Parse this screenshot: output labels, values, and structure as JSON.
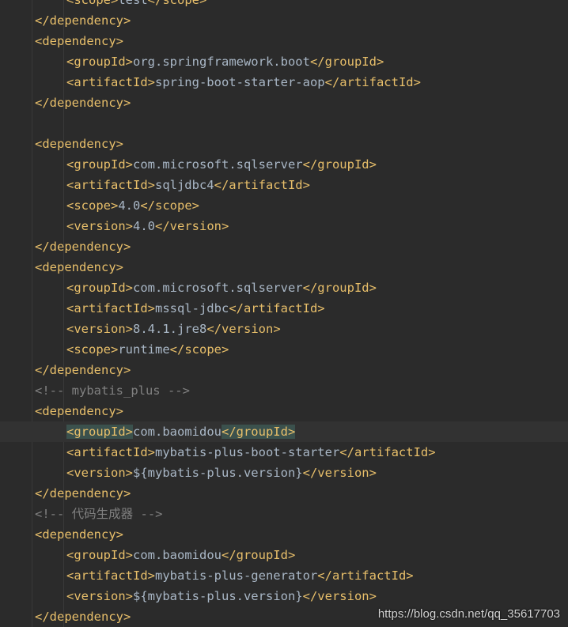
{
  "editor": {
    "language": "xml",
    "colors": {
      "background": "#2b2b2b",
      "tag": "#e8bf6a",
      "text": "#a9b7c6",
      "comment": "#808080",
      "current_line": "#323232",
      "matched_tag_highlight": "#3b514d"
    },
    "lines": [
      {
        "indent": 2,
        "tag": "scope",
        "text": "test",
        "partial": true
      },
      {
        "indent": 1,
        "close": "dependency"
      },
      {
        "indent": 1,
        "open": "dependency"
      },
      {
        "indent": 2,
        "tag": "groupId",
        "text": "org.springframework.boot"
      },
      {
        "indent": 2,
        "tag": "artifactId",
        "text": "spring-boot-starter-aop"
      },
      {
        "indent": 1,
        "close": "dependency"
      },
      {
        "blank": true
      },
      {
        "indent": 1,
        "open": "dependency"
      },
      {
        "indent": 2,
        "tag": "groupId",
        "text": "com.microsoft.sqlserver"
      },
      {
        "indent": 2,
        "tag": "artifactId",
        "text": "sqljdbc4"
      },
      {
        "indent": 2,
        "tag": "scope",
        "text": "4.0"
      },
      {
        "indent": 2,
        "tag": "version",
        "text": "4.0"
      },
      {
        "indent": 1,
        "close": "dependency"
      },
      {
        "indent": 1,
        "open": "dependency"
      },
      {
        "indent": 2,
        "tag": "groupId",
        "text": "com.microsoft.sqlserver"
      },
      {
        "indent": 2,
        "tag": "artifactId",
        "text": "mssql-jdbc"
      },
      {
        "indent": 2,
        "tag": "version",
        "text": "8.4.1.jre8"
      },
      {
        "indent": 2,
        "tag": "scope",
        "text": "runtime"
      },
      {
        "indent": 1,
        "close": "dependency"
      },
      {
        "indent": 1,
        "comment": "<!-- mybatis_plus -->"
      },
      {
        "indent": 1,
        "open": "dependency"
      },
      {
        "indent": 2,
        "tag": "groupId",
        "text": "com.baomidou",
        "current": true
      },
      {
        "indent": 2,
        "tag": "artifactId",
        "text": "mybatis-plus-boot-starter"
      },
      {
        "indent": 2,
        "tag": "version",
        "text": "${mybatis-plus.version}"
      },
      {
        "indent": 1,
        "close": "dependency"
      },
      {
        "indent": 1,
        "comment": "<!-- 代码生成器 -->"
      },
      {
        "indent": 1,
        "open": "dependency"
      },
      {
        "indent": 2,
        "tag": "groupId",
        "text": "com.baomidou"
      },
      {
        "indent": 2,
        "tag": "artifactId",
        "text": "mybatis-plus-generator"
      },
      {
        "indent": 2,
        "tag": "version",
        "text": "${mybatis-plus.version}"
      },
      {
        "indent": 1,
        "close": "dependency"
      }
    ]
  },
  "watermark": "https://blog.csdn.net/qq_35617703"
}
